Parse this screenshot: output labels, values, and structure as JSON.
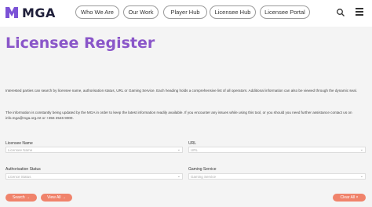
{
  "header": {
    "logo_text": "MGA",
    "nav": [
      "Who We Are",
      "Our Work",
      "Player Hub",
      "Licensee Hub",
      "Licensee Portal"
    ]
  },
  "page": {
    "title": "Licensee Register",
    "para1": "Interested parties can search by licensee name, authorisation status, URL or Gaming Service. Each heading holds a comprehensive list of all operators. Additional information can also be viewed through the dynamic seal.",
    "para2": "The information is constantly being updated by the MGA in order to keep the latest information readily available. If you encounter any issues while using this tool, or you should you need further assistance contact us on info.mga@mga.org.mt or +356 2546 9000."
  },
  "filters": {
    "licensee_name": {
      "label": "Licensee Name",
      "placeholder": "Licensee Name"
    },
    "url": {
      "label": "URL",
      "placeholder": "URL"
    },
    "authorisation_status": {
      "label": "Authorisation Status",
      "placeholder": "Licence Status"
    },
    "gaming_service": {
      "label": "Gaming Service",
      "placeholder": "Gaming Service"
    }
  },
  "buttons": {
    "search": "Search →",
    "view_all": "View All →",
    "clear_all": "Clear All ×"
  },
  "colors": {
    "accent": "#8a56c9",
    "button": "#f0836b",
    "logo": "#7b52d6"
  },
  "icons": {
    "search": "search-icon",
    "menu": "hamburger-menu-icon"
  }
}
